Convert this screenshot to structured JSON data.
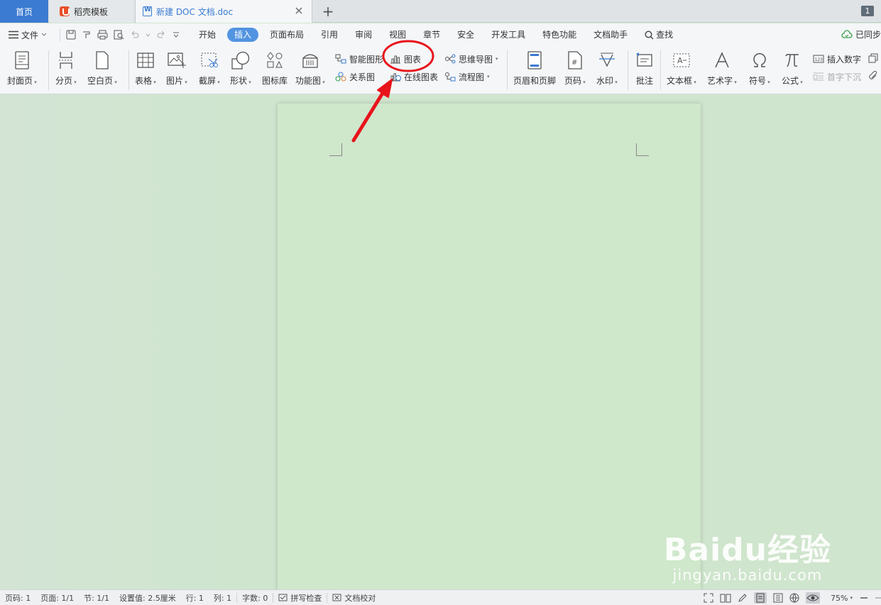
{
  "tabs": {
    "home": "首页",
    "daoke": "稻壳模板",
    "document": "新建 DOC 文档.doc",
    "add": "+",
    "window_count": "1"
  },
  "menu": {
    "file": "文件",
    "tabs": [
      "开始",
      "插入",
      "页面布局",
      "引用",
      "审阅",
      "视图",
      "章节",
      "安全",
      "开发工具",
      "特色功能",
      "文档助手"
    ],
    "active_tab": "插入",
    "search": "查找",
    "sync": "已同步"
  },
  "ribbon": {
    "cover": "封面页",
    "page_break": "分页",
    "blank_page": "空白页",
    "table": "表格",
    "picture": "图片",
    "screenshot": "截屏",
    "shape": "形状",
    "icon_library": "图标库",
    "function_chart": "功能图",
    "smart_art": "智能图形",
    "chart": "图表",
    "relation_chart": "关系图",
    "online_chart": "在线图表",
    "mind_map": "思维导图",
    "flowchart": "流程图",
    "header_footer": "页眉和页脚",
    "page_number": "页码",
    "watermark": "水印",
    "comment": "批注",
    "text_box": "文本框",
    "word_art": "艺术字",
    "symbol": "符号",
    "formula": "公式",
    "insert_number": "插入数字",
    "drop_cap": "首字下沉"
  },
  "status": {
    "page_no": "页码: 1",
    "pages": "页面: 1/1",
    "section": "节: 1/1",
    "position": "设置值: 2.5厘米",
    "line": "行: 1",
    "column": "列: 1",
    "word_count": "字数: 0",
    "spell_check": "拼写检查",
    "proofread": "文档校对",
    "zoom": "75%"
  },
  "watermark": {
    "brand": "Baidu经验",
    "url": "jingyan.baidu.com"
  },
  "colors": {
    "accent": "#3b7bd1",
    "active_tab": "#5294e2",
    "annotation": "#e8141b",
    "canvas": "#cfe7cb"
  }
}
